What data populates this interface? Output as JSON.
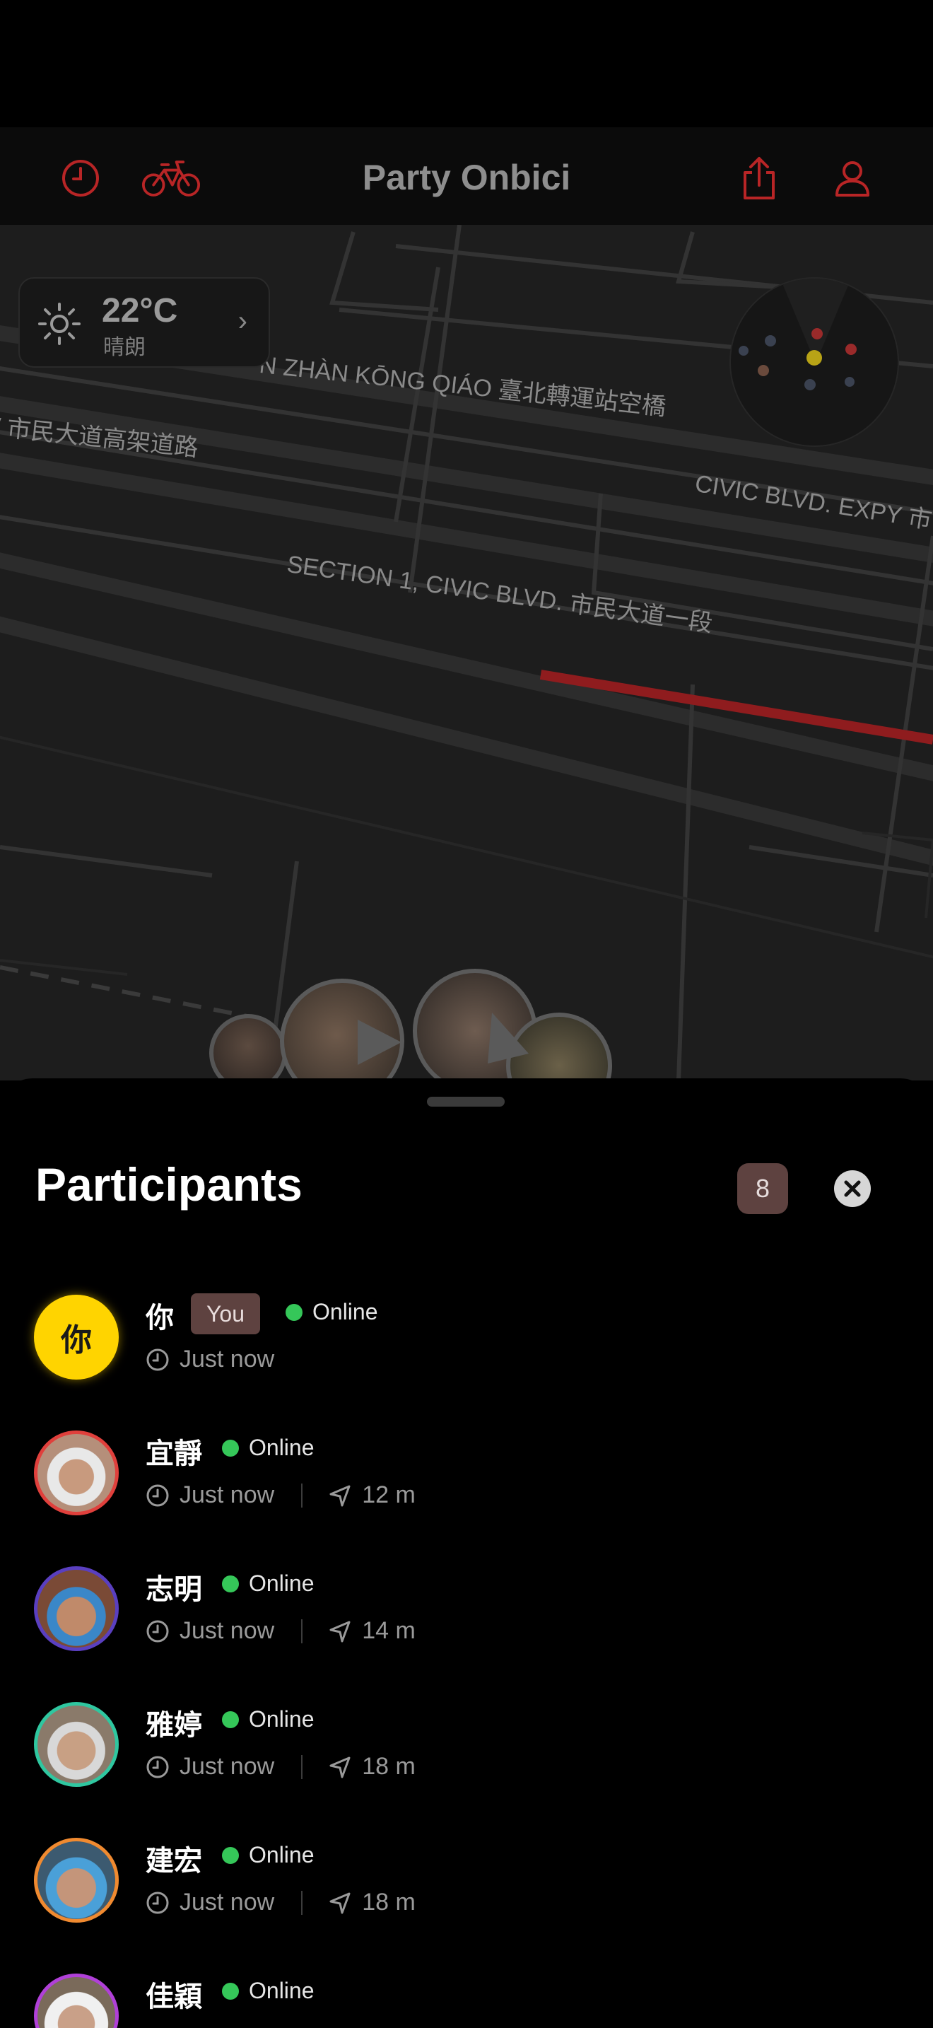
{
  "header": {
    "title": "Party Onbici",
    "icons": [
      "clock-icon",
      "bicycle-icon",
      "share-icon",
      "profile-icon"
    ]
  },
  "map": {
    "weather": {
      "temp": "22°C",
      "condition": "晴朗",
      "icon": "sun-icon"
    },
    "labels": [
      "N ZHÀN KŌNG QIÁO 臺北轉運站空橋",
      "/ 市民大道高架道路",
      "CIVIC BLVD. EXPY 市",
      "SECTION 1, CIVIC BLVD. 市民大道一段"
    ]
  },
  "sheet": {
    "title": "Participants",
    "count": "8",
    "participants": [
      {
        "name": "你",
        "avatar_text": "你",
        "you_label": "You",
        "status": "Online",
        "time": "Just now",
        "distance": "",
        "ring": "#ffd400"
      },
      {
        "name": "宜靜",
        "status": "Online",
        "time": "Just now",
        "distance": "12 m",
        "ring": "#e0403c"
      },
      {
        "name": "志明",
        "status": "Online",
        "time": "Just now",
        "distance": "14 m",
        "ring": "#5a3fc0"
      },
      {
        "name": "雅婷",
        "status": "Online",
        "time": "Just now",
        "distance": "18 m",
        "ring": "#2fc7a0"
      },
      {
        "name": "建宏",
        "status": "Online",
        "time": "Just now",
        "distance": "18 m",
        "ring": "#f08a30"
      },
      {
        "name": "佳穎",
        "status": "Online",
        "time": "",
        "distance": "",
        "ring": "#b040d8"
      }
    ]
  },
  "colors": {
    "accent": "#c0282a",
    "online": "#35c759",
    "badge": "#5e4240",
    "you_avatar": "#ffd400"
  }
}
